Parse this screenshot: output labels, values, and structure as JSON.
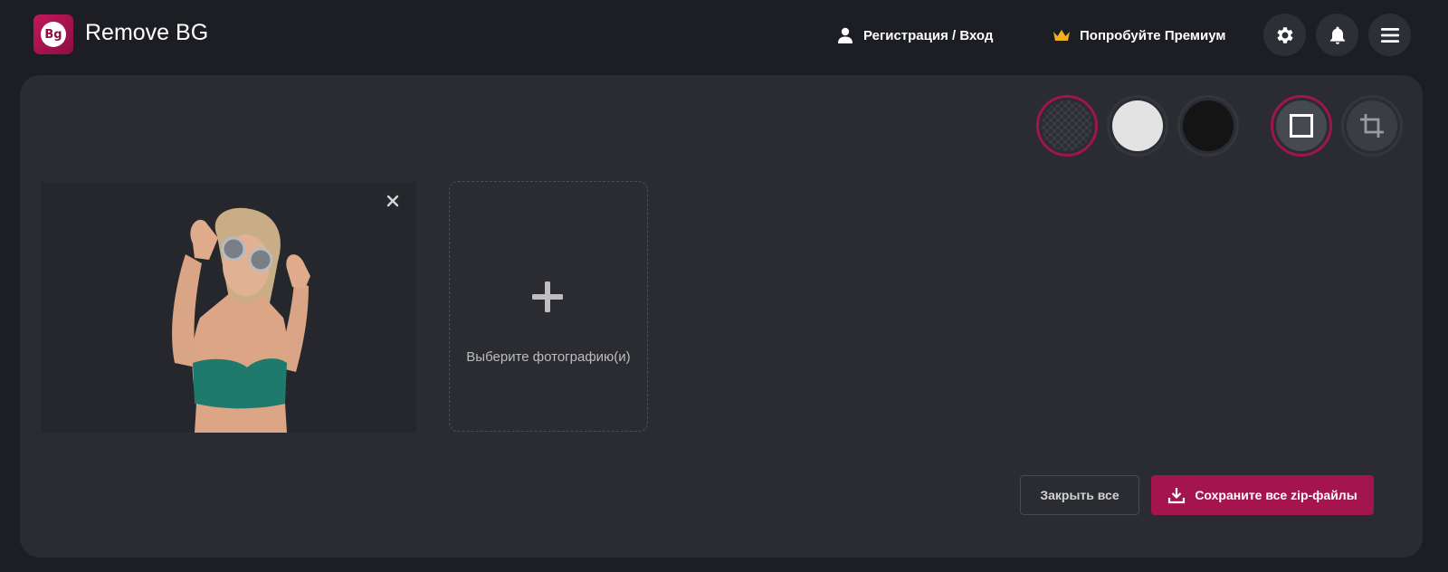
{
  "header": {
    "logo_text": "Bg",
    "app_title": "Remove BG",
    "login_label": "Регистрация / Вход",
    "premium_label": "Попробуйте Премиум",
    "icons": {
      "user": "user-icon",
      "crown": "crown-icon",
      "settings": "gear-icon",
      "notifications": "bell-icon",
      "menu": "hamburger-menu-icon"
    }
  },
  "toolbar": {
    "background_options": [
      {
        "name": "transparent",
        "selected": true
      },
      {
        "name": "white",
        "color": "#e3e3e3",
        "selected": false
      },
      {
        "name": "black",
        "color": "#141414",
        "selected": false
      }
    ],
    "view_options": [
      {
        "name": "frame",
        "icon": "square-frame-icon",
        "selected": true
      },
      {
        "name": "crop",
        "icon": "crop-icon",
        "selected": false
      }
    ]
  },
  "images": [
    {
      "description_icon": "cutout-photo",
      "close_icon": "close-icon"
    }
  ],
  "upload": {
    "label": "Выберите фотографию(и)",
    "icon": "plus-icon"
  },
  "actions": {
    "close_all_label": "Закрыть все",
    "save_zip_label": "Сохраните все zip-файлы",
    "save_icon": "download-icon"
  },
  "colors": {
    "accent": "#a4154f",
    "page_bg": "#1c1e23",
    "panel_bg": "#2a2c32"
  }
}
